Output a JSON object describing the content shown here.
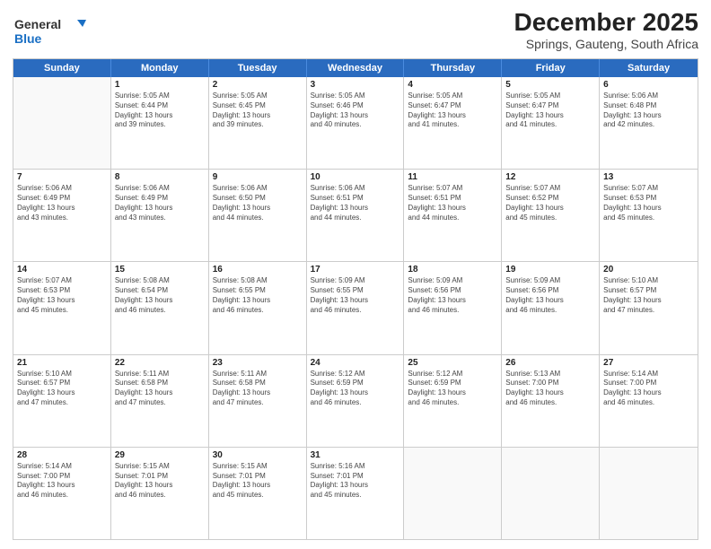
{
  "title": "December 2025",
  "subtitle": "Springs, Gauteng, South Africa",
  "logo": {
    "general": "General",
    "blue": "Blue"
  },
  "days": [
    "Sunday",
    "Monday",
    "Tuesday",
    "Wednesday",
    "Thursday",
    "Friday",
    "Saturday"
  ],
  "weeks": [
    [
      {
        "num": "",
        "lines": []
      },
      {
        "num": "1",
        "lines": [
          "Sunrise: 5:05 AM",
          "Sunset: 6:44 PM",
          "Daylight: 13 hours",
          "and 39 minutes."
        ]
      },
      {
        "num": "2",
        "lines": [
          "Sunrise: 5:05 AM",
          "Sunset: 6:45 PM",
          "Daylight: 13 hours",
          "and 39 minutes."
        ]
      },
      {
        "num": "3",
        "lines": [
          "Sunrise: 5:05 AM",
          "Sunset: 6:46 PM",
          "Daylight: 13 hours",
          "and 40 minutes."
        ]
      },
      {
        "num": "4",
        "lines": [
          "Sunrise: 5:05 AM",
          "Sunset: 6:47 PM",
          "Daylight: 13 hours",
          "and 41 minutes."
        ]
      },
      {
        "num": "5",
        "lines": [
          "Sunrise: 5:05 AM",
          "Sunset: 6:47 PM",
          "Daylight: 13 hours",
          "and 41 minutes."
        ]
      },
      {
        "num": "6",
        "lines": [
          "Sunrise: 5:06 AM",
          "Sunset: 6:48 PM",
          "Daylight: 13 hours",
          "and 42 minutes."
        ]
      }
    ],
    [
      {
        "num": "7",
        "lines": [
          "Sunrise: 5:06 AM",
          "Sunset: 6:49 PM",
          "Daylight: 13 hours",
          "and 43 minutes."
        ]
      },
      {
        "num": "8",
        "lines": [
          "Sunrise: 5:06 AM",
          "Sunset: 6:49 PM",
          "Daylight: 13 hours",
          "and 43 minutes."
        ]
      },
      {
        "num": "9",
        "lines": [
          "Sunrise: 5:06 AM",
          "Sunset: 6:50 PM",
          "Daylight: 13 hours",
          "and 44 minutes."
        ]
      },
      {
        "num": "10",
        "lines": [
          "Sunrise: 5:06 AM",
          "Sunset: 6:51 PM",
          "Daylight: 13 hours",
          "and 44 minutes."
        ]
      },
      {
        "num": "11",
        "lines": [
          "Sunrise: 5:07 AM",
          "Sunset: 6:51 PM",
          "Daylight: 13 hours",
          "and 44 minutes."
        ]
      },
      {
        "num": "12",
        "lines": [
          "Sunrise: 5:07 AM",
          "Sunset: 6:52 PM",
          "Daylight: 13 hours",
          "and 45 minutes."
        ]
      },
      {
        "num": "13",
        "lines": [
          "Sunrise: 5:07 AM",
          "Sunset: 6:53 PM",
          "Daylight: 13 hours",
          "and 45 minutes."
        ]
      }
    ],
    [
      {
        "num": "14",
        "lines": [
          "Sunrise: 5:07 AM",
          "Sunset: 6:53 PM",
          "Daylight: 13 hours",
          "and 45 minutes."
        ]
      },
      {
        "num": "15",
        "lines": [
          "Sunrise: 5:08 AM",
          "Sunset: 6:54 PM",
          "Daylight: 13 hours",
          "and 46 minutes."
        ]
      },
      {
        "num": "16",
        "lines": [
          "Sunrise: 5:08 AM",
          "Sunset: 6:55 PM",
          "Daylight: 13 hours",
          "and 46 minutes."
        ]
      },
      {
        "num": "17",
        "lines": [
          "Sunrise: 5:09 AM",
          "Sunset: 6:55 PM",
          "Daylight: 13 hours",
          "and 46 minutes."
        ]
      },
      {
        "num": "18",
        "lines": [
          "Sunrise: 5:09 AM",
          "Sunset: 6:56 PM",
          "Daylight: 13 hours",
          "and 46 minutes."
        ]
      },
      {
        "num": "19",
        "lines": [
          "Sunrise: 5:09 AM",
          "Sunset: 6:56 PM",
          "Daylight: 13 hours",
          "and 46 minutes."
        ]
      },
      {
        "num": "20",
        "lines": [
          "Sunrise: 5:10 AM",
          "Sunset: 6:57 PM",
          "Daylight: 13 hours",
          "and 47 minutes."
        ]
      }
    ],
    [
      {
        "num": "21",
        "lines": [
          "Sunrise: 5:10 AM",
          "Sunset: 6:57 PM",
          "Daylight: 13 hours",
          "and 47 minutes."
        ]
      },
      {
        "num": "22",
        "lines": [
          "Sunrise: 5:11 AM",
          "Sunset: 6:58 PM",
          "Daylight: 13 hours",
          "and 47 minutes."
        ]
      },
      {
        "num": "23",
        "lines": [
          "Sunrise: 5:11 AM",
          "Sunset: 6:58 PM",
          "Daylight: 13 hours",
          "and 47 minutes."
        ]
      },
      {
        "num": "24",
        "lines": [
          "Sunrise: 5:12 AM",
          "Sunset: 6:59 PM",
          "Daylight: 13 hours",
          "and 46 minutes."
        ]
      },
      {
        "num": "25",
        "lines": [
          "Sunrise: 5:12 AM",
          "Sunset: 6:59 PM",
          "Daylight: 13 hours",
          "and 46 minutes."
        ]
      },
      {
        "num": "26",
        "lines": [
          "Sunrise: 5:13 AM",
          "Sunset: 7:00 PM",
          "Daylight: 13 hours",
          "and 46 minutes."
        ]
      },
      {
        "num": "27",
        "lines": [
          "Sunrise: 5:14 AM",
          "Sunset: 7:00 PM",
          "Daylight: 13 hours",
          "and 46 minutes."
        ]
      }
    ],
    [
      {
        "num": "28",
        "lines": [
          "Sunrise: 5:14 AM",
          "Sunset: 7:00 PM",
          "Daylight: 13 hours",
          "and 46 minutes."
        ]
      },
      {
        "num": "29",
        "lines": [
          "Sunrise: 5:15 AM",
          "Sunset: 7:01 PM",
          "Daylight: 13 hours",
          "and 46 minutes."
        ]
      },
      {
        "num": "30",
        "lines": [
          "Sunrise: 5:15 AM",
          "Sunset: 7:01 PM",
          "Daylight: 13 hours",
          "and 45 minutes."
        ]
      },
      {
        "num": "31",
        "lines": [
          "Sunrise: 5:16 AM",
          "Sunset: 7:01 PM",
          "Daylight: 13 hours",
          "and 45 minutes."
        ]
      },
      {
        "num": "",
        "lines": []
      },
      {
        "num": "",
        "lines": []
      },
      {
        "num": "",
        "lines": []
      }
    ]
  ]
}
